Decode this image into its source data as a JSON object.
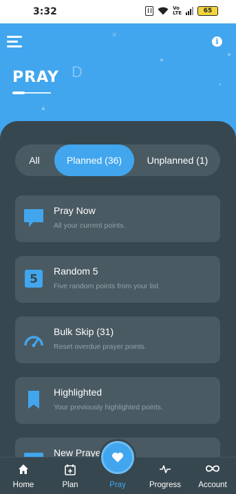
{
  "status_bar": {
    "time": "3:32",
    "battery": "65",
    "volte_label": "Vo\nLTE"
  },
  "header": {
    "title": "PRAY",
    "background_color": "#41a6ee"
  },
  "filter_tabs": {
    "all": "All",
    "planned": "Planned (36)",
    "unplanned": "Unplanned (1)",
    "selected": "planned"
  },
  "cards": [
    {
      "title": "Pray Now",
      "subtitle": "All your current points.",
      "icon": "chat-bubble-icon"
    },
    {
      "title": "Random 5",
      "subtitle": "Five random points from your list",
      "icon": "five-icon",
      "icon_text": "5"
    },
    {
      "title": "Bulk Skip (31)",
      "subtitle": "Reset overdue prayer points.",
      "icon": "gauge-icon"
    },
    {
      "title": "Highlighted",
      "subtitle": "Your previously highlighted points.",
      "icon": "bookmark-icon"
    },
    {
      "title": "New Prayer",
      "subtitle": "",
      "icon": "card-icon"
    }
  ],
  "bottom_nav": {
    "items": [
      {
        "label": "Home",
        "icon": "home-icon"
      },
      {
        "label": "Plan",
        "icon": "calendar-add-icon"
      },
      {
        "label": "Pray",
        "icon": "heart-icon",
        "active": true
      },
      {
        "label": "Progress",
        "icon": "pulse-icon"
      },
      {
        "label": "Account",
        "icon": "infinity-icon"
      }
    ]
  },
  "colors": {
    "accent": "#41a6ee",
    "panel": "#37474f",
    "card": "#4a5a63"
  }
}
